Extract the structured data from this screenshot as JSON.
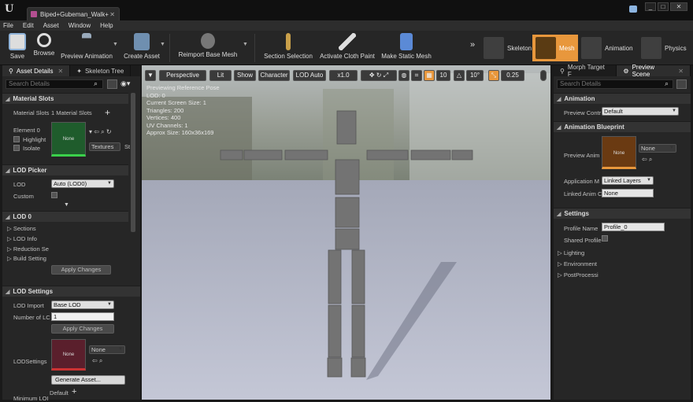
{
  "window": {
    "tab_title": "Biped+Gubeman_Walk+",
    "controls": [
      "_",
      "□",
      "✕"
    ]
  },
  "menu": [
    "File",
    "Edit",
    "Asset",
    "Window",
    "Help"
  ],
  "toolbar": {
    "save": "Save",
    "browse": "Browse",
    "preview_animation": "Preview Animation",
    "create_asset": "Create Asset",
    "reimport": "Reimport Base Mesh",
    "section_selection": "Section Selection",
    "activate_cloth": "Activate Cloth Paint",
    "make_static_mesh": "Make Static Mesh",
    "modes": [
      "Skeleton",
      "Mesh",
      "Animation",
      "Physics"
    ],
    "active_mode": "Mesh"
  },
  "left_panel": {
    "tabs": [
      "Asset Details",
      "Skeleton Tree"
    ],
    "search_placeholder": "Search Details",
    "material_slots": {
      "header": "Material Slots",
      "label": "Material Slots",
      "value": "1 Material Slots",
      "element": "Element 0",
      "highlight": "Highlight",
      "isolate": "Isolate",
      "thumb_label": "None",
      "textures_dd": "Textures",
      "st": "St"
    },
    "lod_picker": {
      "header": "LOD Picker",
      "lod_label": "LOD",
      "lod_value": "Auto (LOD0)",
      "custom_label": "Custom"
    },
    "lod0": {
      "header": "LOD 0",
      "items": [
        "Sections",
        "LOD Info",
        "Reduction Se",
        "Build Setting"
      ],
      "apply": "Apply Changes"
    },
    "lod_settings": {
      "header": "LOD Settings",
      "import_label": "LOD Import",
      "import_value": "Base LOD",
      "number_label": "Number of LC",
      "number_value": "1",
      "apply": "Apply Changes",
      "settings_label": "LODSettings",
      "thumb_label": "None",
      "none_dd": "None",
      "generate": "Generate Asset...",
      "minimum_label": "Minimum LOI",
      "default_label": "Default"
    }
  },
  "viewport": {
    "buttons": [
      "Perspective",
      "Lit",
      "Show",
      "Character",
      "LOD Auto"
    ],
    "speed": "x1.0",
    "grid": "10",
    "angle": "10°",
    "scale": "0.25",
    "stats": [
      "Previewing Reference Pose",
      "LOD: 0",
      "Current Screen Size: 1",
      "Triangles: 200",
      "Vertices: 400",
      "UV Channels: 1",
      "Approx Size: 160x36x169"
    ]
  },
  "right_panel": {
    "tabs": [
      "Morph Target F",
      "Preview Scene"
    ],
    "search_placeholder": "Search Details",
    "animation": {
      "header": "Animation",
      "preview_label": "Preview Contr",
      "preview_value": "Default"
    },
    "anim_blueprint": {
      "header": "Animation Blueprint",
      "preview_anim_label": "Preview Anim",
      "thumb_label": "None",
      "none_dd": "None",
      "app_label": "Application M",
      "app_value": "Linked Layers",
      "linked_label": "Linked Anim C",
      "linked_value": "None"
    },
    "settings": {
      "header": "Settings",
      "profile_label": "Profile Name",
      "profile_value": "Profile_0",
      "shared_label": "Shared Profile",
      "items": [
        "Lighting",
        "Environment",
        "PostProcessi"
      ]
    }
  }
}
